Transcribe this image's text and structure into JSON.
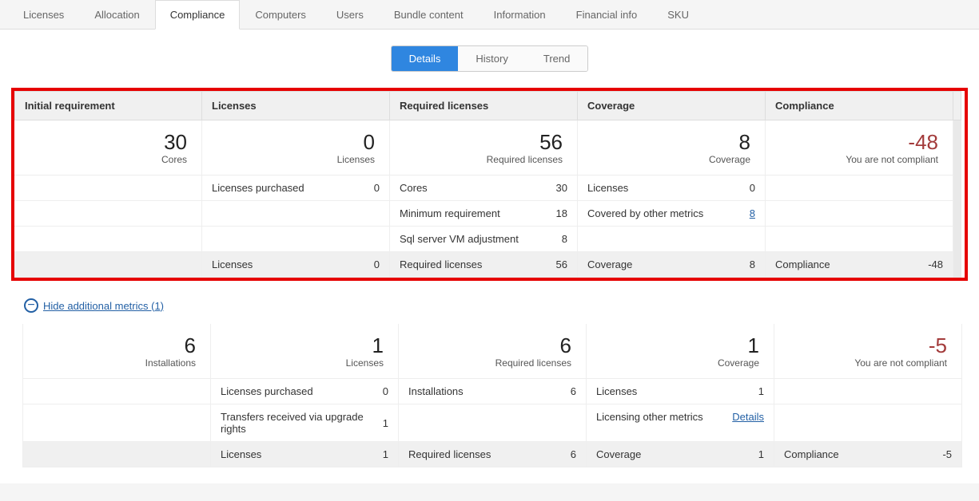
{
  "tabs": [
    "Licenses",
    "Allocation",
    "Compliance",
    "Computers",
    "Users",
    "Bundle content",
    "Information",
    "Financial info",
    "SKU"
  ],
  "active_tab_index": 2,
  "sub_tabs": [
    "Details",
    "History",
    "Trend"
  ],
  "active_sub_tab_index": 0,
  "headers": {
    "initial": "Initial requirement",
    "licenses": "Licenses",
    "required": "Required licenses",
    "coverage": "Coverage",
    "compliance": "Compliance"
  },
  "toggle_label": "Hide additional metrics (1)",
  "block1": {
    "summary": {
      "initial": {
        "value": "30",
        "label": "Cores"
      },
      "licenses": {
        "value": "0",
        "label": "Licenses"
      },
      "required": {
        "value": "56",
        "label": "Required licenses"
      },
      "coverage": {
        "value": "8",
        "label": "Coverage"
      },
      "compliance": {
        "value": "-48",
        "label": "You are not compliant"
      }
    },
    "details": {
      "licenses": [
        {
          "label": "Licenses purchased",
          "value": "0"
        }
      ],
      "required": [
        {
          "label": "Cores",
          "value": "30"
        },
        {
          "label": "Minimum requirement",
          "value": "18"
        },
        {
          "label": "Sql server VM adjustment",
          "value": "8"
        }
      ],
      "coverage": [
        {
          "label": "Licenses",
          "value": "0"
        },
        {
          "label": "Covered by other metrics",
          "value": "8",
          "link": true
        }
      ]
    },
    "totals": {
      "licenses": {
        "label": "Licenses",
        "value": "0"
      },
      "required": {
        "label": "Required licenses",
        "value": "56"
      },
      "coverage": {
        "label": "Coverage",
        "value": "8"
      },
      "compliance": {
        "label": "Compliance",
        "value": "-48"
      }
    }
  },
  "block2": {
    "summary": {
      "initial": {
        "value": "6",
        "label": "Installations"
      },
      "licenses": {
        "value": "1",
        "label": "Licenses"
      },
      "required": {
        "value": "6",
        "label": "Required licenses"
      },
      "coverage": {
        "value": "1",
        "label": "Coverage"
      },
      "compliance": {
        "value": "-5",
        "label": "You are not compliant"
      }
    },
    "details": {
      "licenses": [
        {
          "label": "Licenses purchased",
          "value": "0"
        },
        {
          "label": "Transfers received via upgrade rights",
          "value": "1"
        }
      ],
      "required": [
        {
          "label": "Installations",
          "value": "6"
        }
      ],
      "coverage": [
        {
          "label": "Licenses",
          "value": "1"
        },
        {
          "label": "Licensing other metrics",
          "value": "Details",
          "link": true
        }
      ]
    },
    "totals": {
      "licenses": {
        "label": "Licenses",
        "value": "1"
      },
      "required": {
        "label": "Required licenses",
        "value": "6"
      },
      "coverage": {
        "label": "Coverage",
        "value": "1"
      },
      "compliance": {
        "label": "Compliance",
        "value": "-5"
      }
    }
  }
}
